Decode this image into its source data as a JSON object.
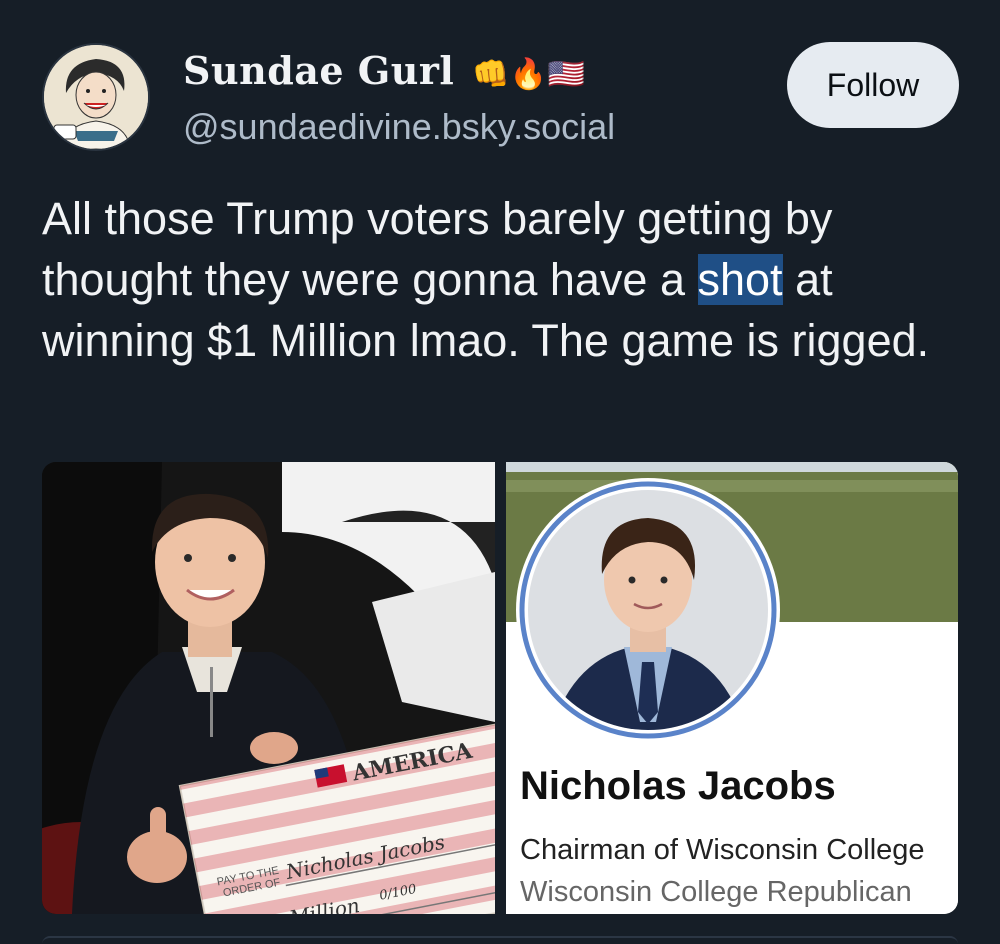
{
  "author": {
    "display_name": "Sundae Gurl",
    "emojis": "👊🔥🇺🇸",
    "handle": "@sundaedivine.bsky.social"
  },
  "follow_label": "Follow",
  "post": {
    "text_before": "All those Trump voters barely getting by thought they were gonna have a ",
    "highlighted": "shot",
    "text_after": " at winning $1 Million lmao. The game is rigged."
  },
  "image_left": {
    "check_brand": "AMERICA",
    "pay_to_label_1": "PAY TO THE",
    "pay_to_label_2": "ORDER OF",
    "payee": "Nicholas Jacobs",
    "amount": "One Million",
    "cents": "0/100"
  },
  "image_right": {
    "name": "Nicholas Jacobs",
    "title": "Chairman of Wisconsin College",
    "org": "Wisconsin College Republican"
  },
  "colors": {
    "background": "#161e27",
    "highlight": "#1f4f86",
    "follow_bg": "#e6ebf1"
  },
  "icons": [
    "fist-emoji-icon",
    "fire-emoji-icon",
    "us-flag-emoji-icon"
  ]
}
